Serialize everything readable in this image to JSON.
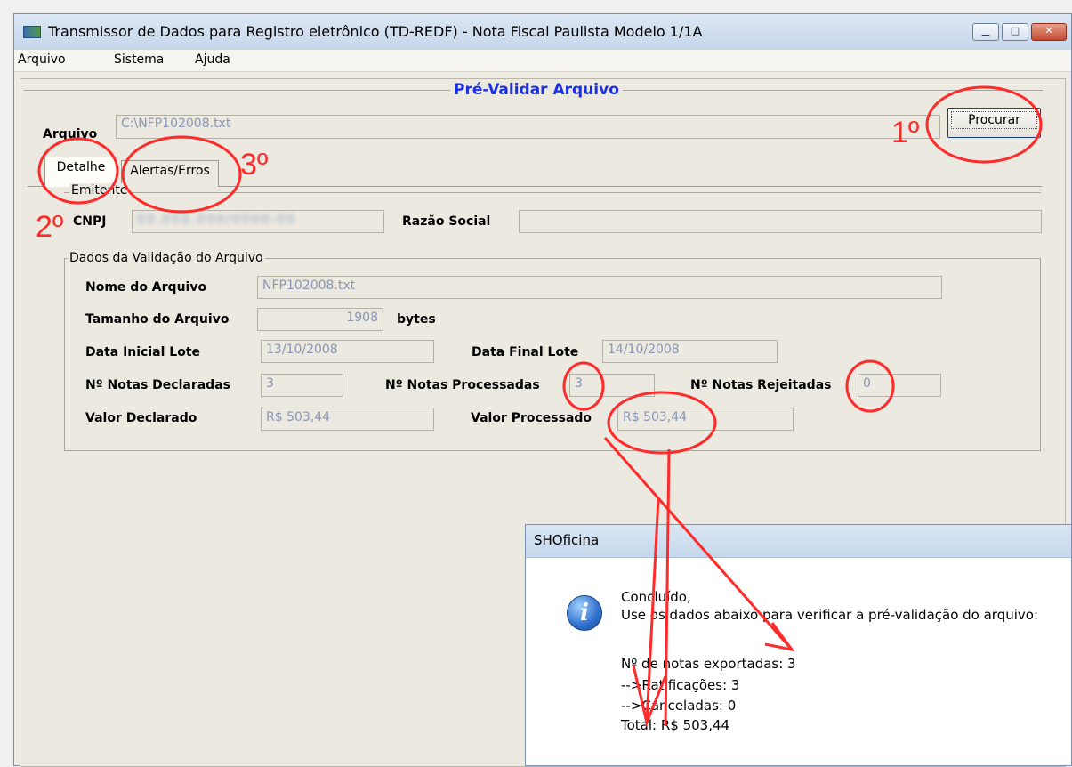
{
  "window": {
    "title": "Transmissor de Dados para Registro eletrônico (TD-REDF) - Nota Fiscal Paulista Modelo 1/1A",
    "buttons": {
      "minimize": "▁",
      "maximize": "□",
      "close": "✕"
    }
  },
  "menu": {
    "items": [
      "Arquivo",
      "Sistema",
      "Ajuda"
    ]
  },
  "main": {
    "section_title": "Pré-Validar Arquivo",
    "arquivo_label": "Arquivo",
    "arquivo_value": "C:\\NFP102008.txt",
    "procurar_button": "Procurar",
    "tabs": [
      "Detalhe",
      "Alertas/Erros"
    ],
    "emitente": {
      "legend": "Emitente",
      "cnpj_label": "CNPJ",
      "cnpj_value": "00.000.000/0000-00",
      "razao_label": "Razão Social",
      "razao_value": ""
    },
    "validacao": {
      "legend": "Dados da Validação do Arquivo",
      "nome_label": "Nome do Arquivo",
      "nome_value": "NFP102008.txt",
      "tamanho_label": "Tamanho do Arquivo",
      "tamanho_value": "1908",
      "tamanho_unit": "bytes",
      "data_inicial_label": "Data Inicial Lote",
      "data_inicial_value": "13/10/2008",
      "data_final_label": "Data Final Lote",
      "data_final_value": "14/10/2008",
      "declaradas_label": "Nº Notas Declaradas",
      "declaradas_value": "3",
      "processadas_label": "Nº Notas Processadas",
      "processadas_value": "3",
      "rejeitadas_label": "Nº Notas Rejeitadas",
      "rejeitadas_value": "0",
      "valor_declarado_label": "Valor Declarado",
      "valor_declarado_value": "R$ 503,44",
      "valor_processado_label": "Valor Processado",
      "valor_processado_value": "R$ 503,44"
    }
  },
  "dialog": {
    "title": "SHOficina",
    "icon": "info-icon",
    "lines": [
      "Concluído,",
      "Use os dados abaixo para verificar a pré-validação do arquivo:",
      "Nº de notas exportadas: 3",
      "-->Ratificações: 3",
      "-->Canceladas: 0",
      "Total: R$ 503,44"
    ]
  },
  "annotations": {
    "step1": "1º",
    "step2": "2º",
    "step3": "3º",
    "color": "#ff2a2a"
  }
}
